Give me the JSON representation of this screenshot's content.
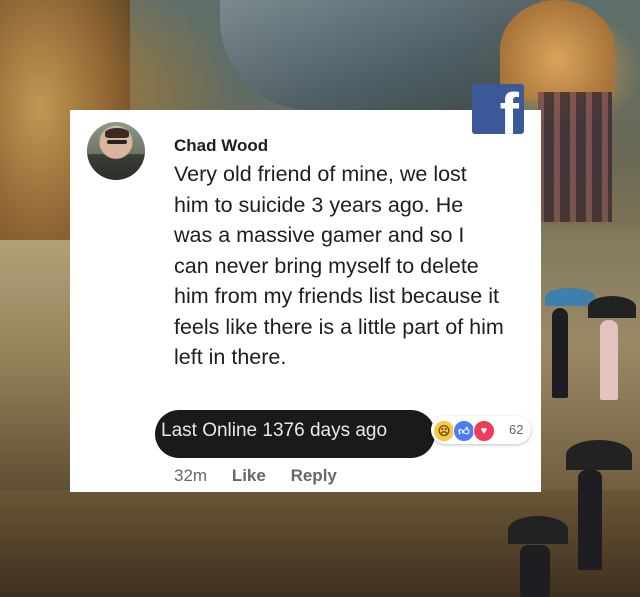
{
  "badge": {
    "label": "f",
    "color": "#3b5998"
  },
  "comment": {
    "author": "Chad Wood",
    "text": "Very old friend of mine, we lost him to suicide 3 years ago. He was a massive gamer and so I can never bring myself to delete him from my friends list because it feels like there is a little part of him left in there.",
    "overlay_status": "Last Online 1376 days ago",
    "reaction_count": "62",
    "reaction_icons": [
      "sad-icon",
      "like-icon",
      "love-icon"
    ],
    "timestamp": "32m",
    "like_label": "Like",
    "reply_label": "Reply"
  },
  "colors": {
    "text": "#1c1e21",
    "meta": "#65676b",
    "like": "#4a7df6",
    "love": "#ef3b5a",
    "sad": "#f7c745"
  }
}
